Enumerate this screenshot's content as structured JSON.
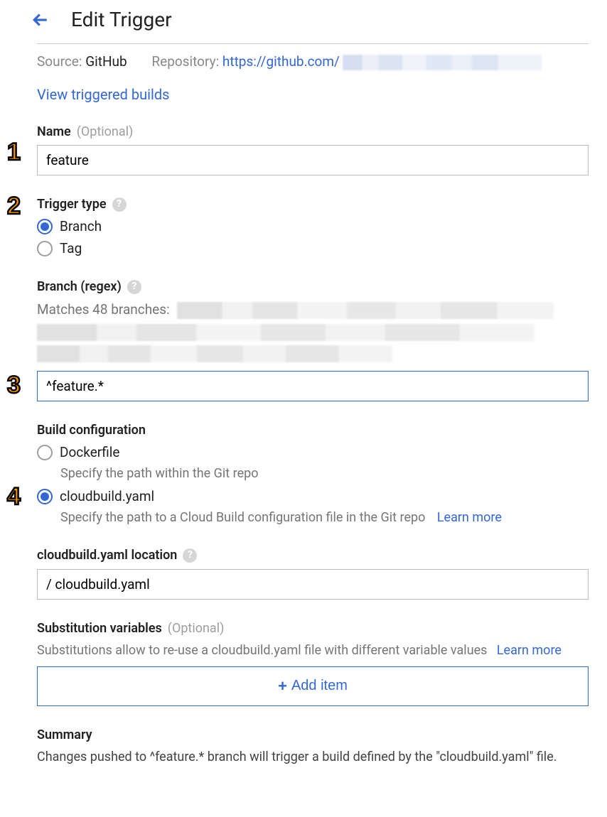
{
  "header": {
    "title": "Edit Trigger"
  },
  "info": {
    "source_label": "Source:",
    "source_value": "GitHub",
    "repo_label": "Repository:",
    "repo_url_prefix": "https://github.com/",
    "view_builds": "View triggered builds"
  },
  "name": {
    "label": "Name",
    "optional": "(Optional)",
    "value": "feature"
  },
  "trigger_type": {
    "label": "Trigger type",
    "options": {
      "branch": "Branch",
      "tag": "Tag"
    }
  },
  "branch_regex": {
    "label": "Branch (regex)",
    "matches_prefix": "Matches 48 branches:",
    "value": "^feature.*"
  },
  "build_config": {
    "label": "Build configuration",
    "dockerfile": {
      "label": "Dockerfile",
      "desc": "Specify the path within the Git repo"
    },
    "cloudbuild": {
      "label": "cloudbuild.yaml",
      "desc": "Specify the path to a Cloud Build configuration file in the Git repo",
      "learn_more": "Learn more"
    }
  },
  "cloudbuild_location": {
    "label": "cloudbuild.yaml location",
    "value": "/ cloudbuild.yaml"
  },
  "substitution": {
    "label": "Substitution variables",
    "optional": "(Optional)",
    "desc": "Substitutions allow to re-use a cloudbuild.yaml file with different variable values",
    "learn_more": "Learn more",
    "add_item": "Add item"
  },
  "summary": {
    "label": "Summary",
    "text": "Changes pushed to ^feature.* branch will trigger a build defined by the \"cloudbuild.yaml\" file."
  },
  "annotations": {
    "n1": "1",
    "n2": "2",
    "n3": "3",
    "n4": "4"
  }
}
